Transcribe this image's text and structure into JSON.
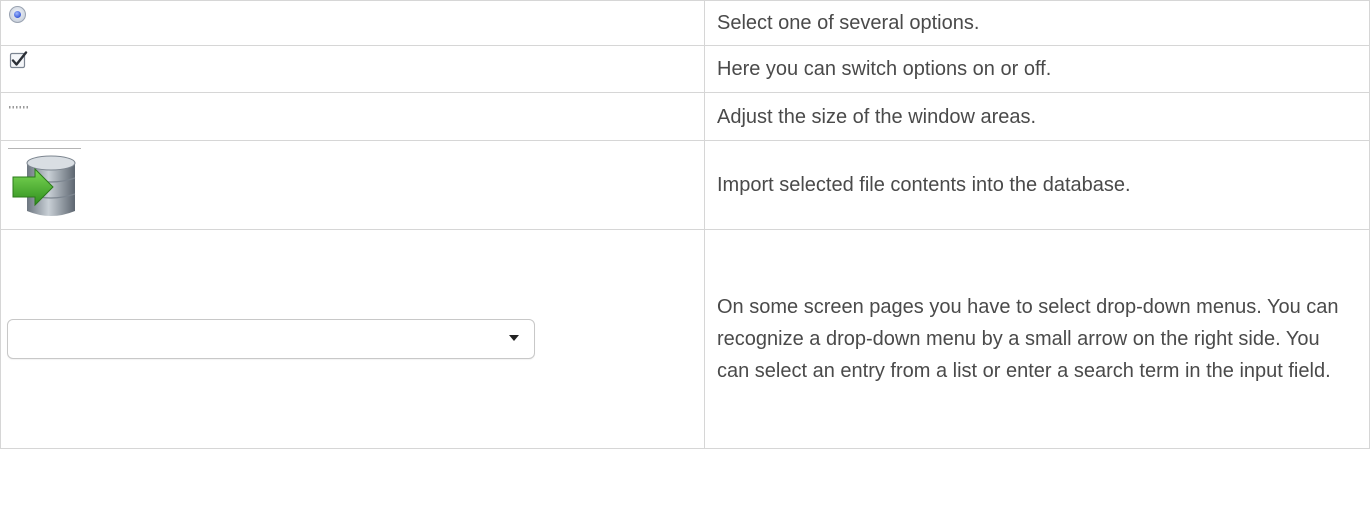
{
  "rows": [
    {
      "icon": "radio-button-icon",
      "description": "Select one of several options."
    },
    {
      "icon": "checkbox-checked-icon",
      "description": "Here you can switch options on or off."
    },
    {
      "icon": "resize-grip-icon",
      "description": "Adjust the size of the window areas."
    },
    {
      "icon": "database-import-icon",
      "description": "Import selected file contents into the database."
    },
    {
      "icon": "dropdown-menu-icon",
      "description": "On some screen pages you have to select drop-down menus. You can recognize a drop-down menu by a small arrow on the right side. You can select an entry from a list or enter a search term in the input field.",
      "dropdown_value": ""
    }
  ],
  "colors": {
    "text": "#4a4a4a",
    "border": "#d6d6d6",
    "radio_dot": "#3a5bd8",
    "import_arrow": "#3fae2a",
    "database": "#8d969f"
  }
}
